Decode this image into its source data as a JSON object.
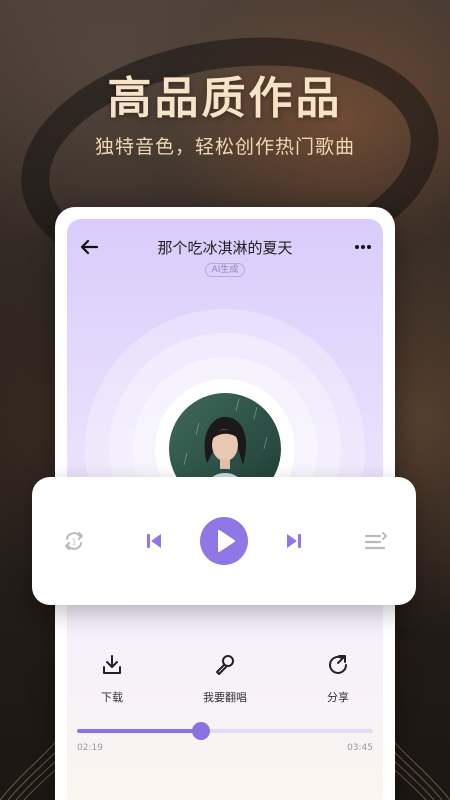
{
  "promo": {
    "headline": "高品质作品",
    "subline": "独特音色，轻松创作热门歌曲"
  },
  "player": {
    "title": "那个吃冰淇淋的夏天",
    "badge": "AI生成",
    "progress_fraction": 0.42,
    "time_current": "02:19",
    "time_total": "03:45"
  },
  "controls": {
    "icons": [
      "repeat-one-icon",
      "previous-icon",
      "play-icon",
      "next-icon",
      "playlist-icon"
    ]
  },
  "actions": [
    {
      "label": "下载",
      "icon": "download-icon"
    },
    {
      "label": "我要翻唱",
      "icon": "microphone-icon"
    },
    {
      "label": "分享",
      "icon": "share-icon"
    }
  ],
  "colors": {
    "accent": "#8f78e6",
    "headline": "#f6e3c8",
    "screen_top": "#d9ccfb"
  }
}
